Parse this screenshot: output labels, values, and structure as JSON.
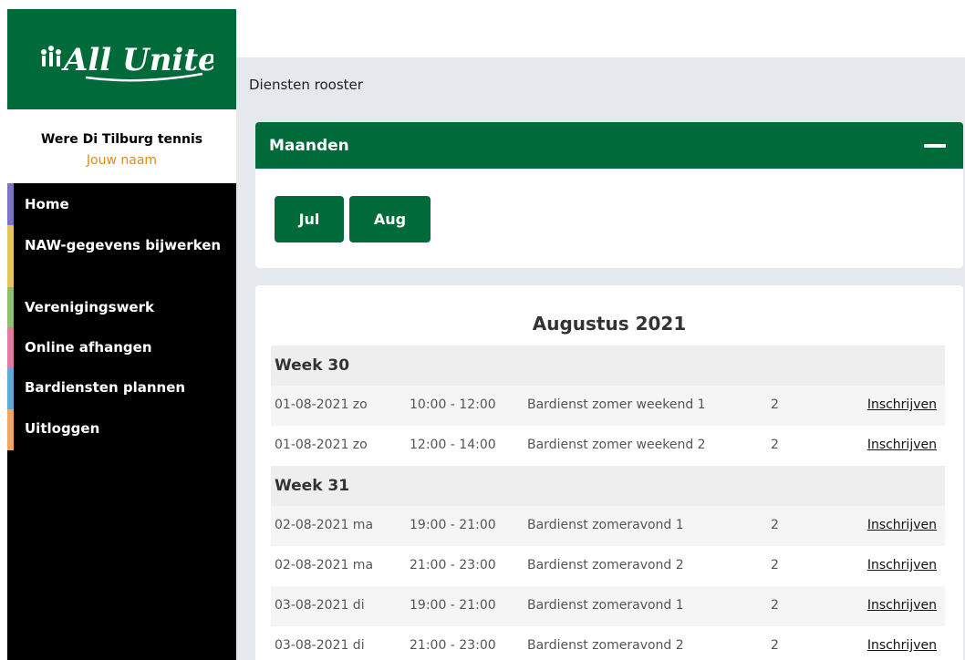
{
  "sidebar": {
    "logo_text": "All United",
    "club_name": "Were Di Tilburg tennis",
    "user_name": "Jouw naam",
    "nav": [
      {
        "label": "Home",
        "color": "#7a74c4"
      },
      {
        "label": "NAW-gegevens bijwerken",
        "color": "#e8c554"
      },
      {
        "label": "Verenigingswerk",
        "color": "#8dbf6e"
      },
      {
        "label": "Online afhangen",
        "color": "#e37aa1"
      },
      {
        "label": "Bardiensten plannen",
        "color": "#5ea9d9"
      },
      {
        "label": "Uitloggen",
        "color": "#f3a55f"
      }
    ]
  },
  "colors": {
    "brand_green": "#006a3b",
    "user_name": "#e08a1a",
    "main_bg": "#e5e8ec"
  },
  "page": {
    "title": "Diensten rooster"
  },
  "months_panel": {
    "title": "Maanden",
    "buttons": [
      "Jul",
      "Aug"
    ]
  },
  "schedule": {
    "month_title": "Augustus 2021",
    "link_label": "Inschrijven",
    "weeks": [
      {
        "label": "Week 30",
        "rows": [
          {
            "date": "01-08-2021 zo",
            "time": "10:00 - 12:00",
            "service": "Bardienst zomer weekend 1",
            "count": "2"
          },
          {
            "date": "01-08-2021 zo",
            "time": "12:00 - 14:00",
            "service": "Bardienst zomer weekend 2",
            "count": "2"
          }
        ]
      },
      {
        "label": "Week 31",
        "rows": [
          {
            "date": "02-08-2021 ma",
            "time": "19:00 - 21:00",
            "service": "Bardienst zomeravond 1",
            "count": "2"
          },
          {
            "date": "02-08-2021 ma",
            "time": "21:00 - 23:00",
            "service": "Bardienst zomeravond 2",
            "count": "2"
          },
          {
            "date": "03-08-2021 di",
            "time": "19:00 - 21:00",
            "service": "Bardienst zomeravond 1",
            "count": "2"
          },
          {
            "date": "03-08-2021 di",
            "time": "21:00 - 23:00",
            "service": "Bardienst zomeravond 2",
            "count": "2"
          }
        ]
      }
    ]
  }
}
